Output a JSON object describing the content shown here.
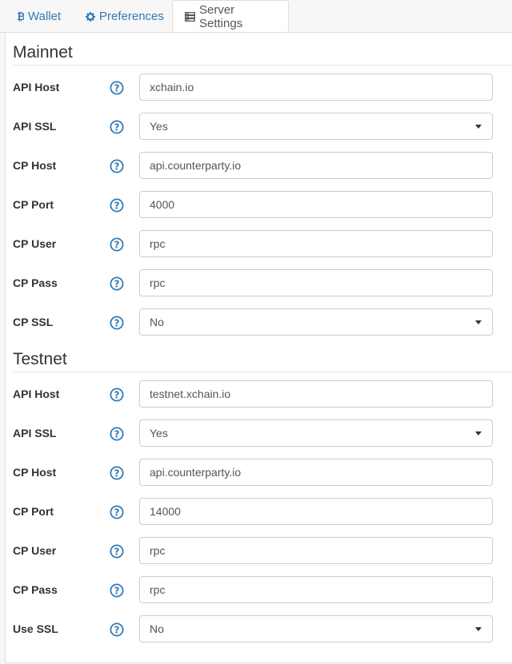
{
  "tabs": [
    {
      "label": "Wallet",
      "icon": "bitcoin-icon"
    },
    {
      "label": "Preferences",
      "icon": "gear-icon"
    },
    {
      "label": "Server Settings",
      "icon": "server-icon",
      "active": true
    }
  ],
  "colors": {
    "accent": "#337ab7",
    "help": "#337ab7"
  },
  "mainnet": {
    "title": "Mainnet",
    "api_host": {
      "label": "API Host",
      "value": "xchain.io"
    },
    "api_ssl": {
      "label": "API SSL",
      "value": "Yes"
    },
    "cp_host": {
      "label": "CP Host",
      "value": "api.counterparty.io"
    },
    "cp_port": {
      "label": "CP Port",
      "value": "4000"
    },
    "cp_user": {
      "label": "CP User",
      "value": "rpc"
    },
    "cp_pass": {
      "label": "CP Pass",
      "value": "rpc"
    },
    "cp_ssl": {
      "label": "CP SSL",
      "value": "No"
    }
  },
  "testnet": {
    "title": "Testnet",
    "api_host": {
      "label": "API Host",
      "value": "testnet.xchain.io"
    },
    "api_ssl": {
      "label": "API SSL",
      "value": "Yes"
    },
    "cp_host": {
      "label": "CP Host",
      "value": "api.counterparty.io"
    },
    "cp_port": {
      "label": "CP Port",
      "value": "14000"
    },
    "cp_user": {
      "label": "CP User",
      "value": "rpc"
    },
    "cp_pass": {
      "label": "CP Pass",
      "value": "rpc"
    },
    "use_ssl": {
      "label": "Use SSL",
      "value": "No"
    }
  }
}
